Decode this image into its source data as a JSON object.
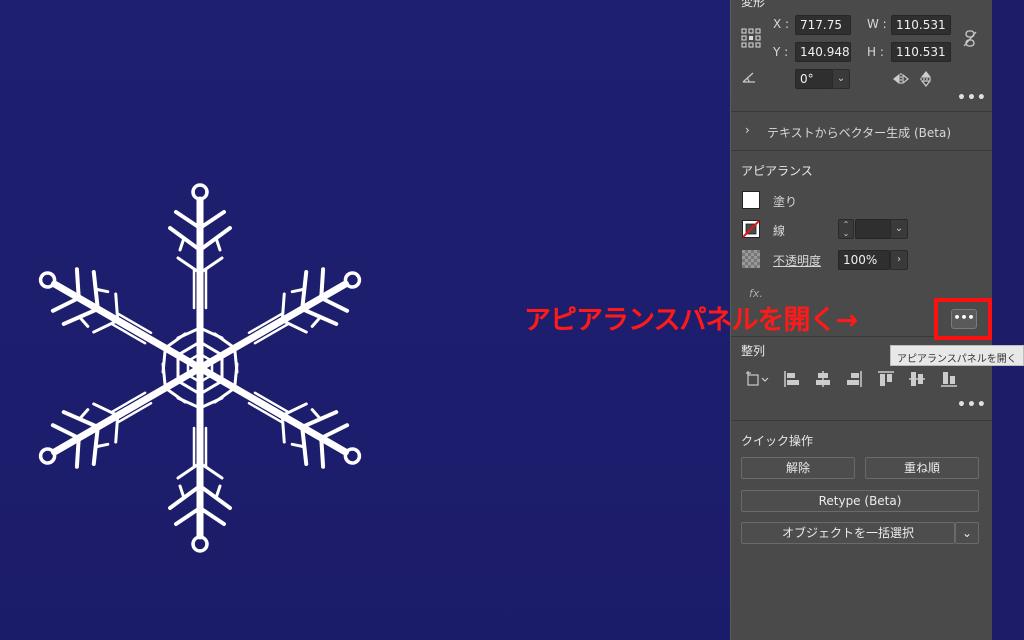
{
  "transform": {
    "title": "変形",
    "x_label": "X :",
    "x_value": "717.75",
    "y_label": "Y :",
    "y_value": "140.948",
    "w_label": "W :",
    "w_value": "110.531",
    "h_label": "H :",
    "h_value": "110.531",
    "angle_value": "0°",
    "more": "•••"
  },
  "text_to_vector": {
    "label": "テキストからベクター生成 (Beta)"
  },
  "appearance": {
    "title": "アピアランス",
    "fill_label": "塗り",
    "stroke_label": "線",
    "opacity_label": "不透明度",
    "opacity_value": "100%",
    "fx_label": "fx.",
    "open_button": "•••"
  },
  "align": {
    "title": "整列",
    "more": "•••"
  },
  "quick_actions": {
    "title": "クイック操作",
    "release": "解除",
    "arrange": "重ね順",
    "retype": "Retype (Beta)",
    "select_same": "オブジェクトを一括選択"
  },
  "annotation": {
    "text": "アピアランスパネルを開く→"
  },
  "tooltip": {
    "text": "アピアランスパネルを開く"
  },
  "colors": {
    "artboard": "#1f1f72",
    "panel": "#4a4a4a",
    "annotation": "#ff1a1a"
  }
}
